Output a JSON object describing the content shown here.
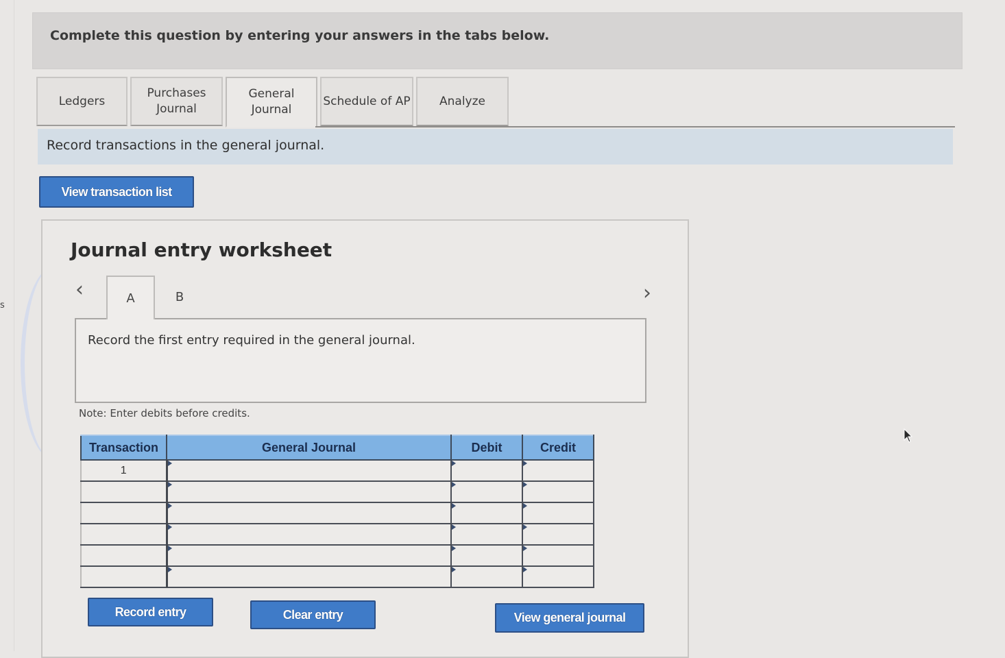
{
  "left_edge": {
    "char": "s"
  },
  "instruction": {
    "text": "Complete this question by entering your answers in the tabs below."
  },
  "tabs": [
    {
      "label_line1": "Ledgers",
      "label_line2": "",
      "active": false
    },
    {
      "label_line1": "Purchases",
      "label_line2": "Journal",
      "active": false
    },
    {
      "label_line1": "General",
      "label_line2": "Journal",
      "active": true
    },
    {
      "label_line1": "Schedule of AP",
      "label_line2": "",
      "active": false
    },
    {
      "label_line1": "Analyze",
      "label_line2": "",
      "active": false
    }
  ],
  "subtitle": {
    "text": "Record transactions in the general journal."
  },
  "buttons": {
    "view_transaction_list": "View transaction list",
    "record_entry": "Record entry",
    "clear_entry": "Clear entry",
    "view_general_journal": "View general journal"
  },
  "worksheet": {
    "title": "Journal entry worksheet",
    "nav_prev_icon": "chevron-left-icon",
    "nav_next_icon": "chevron-right-icon",
    "entry_tabs": [
      {
        "label": "A",
        "active": true
      },
      {
        "label": "B",
        "active": false
      }
    ],
    "entry_instruction": "Record the first entry required in the general journal.",
    "note": "Note: Enter debits before credits."
  },
  "journal_table": {
    "columns": [
      "Transaction",
      "General Journal",
      "Debit",
      "Credit"
    ],
    "rows": [
      {
        "transaction": "1",
        "account": "",
        "debit": "",
        "credit": ""
      },
      {
        "transaction": "",
        "account": "",
        "debit": "",
        "credit": ""
      },
      {
        "transaction": "",
        "account": "",
        "debit": "",
        "credit": ""
      },
      {
        "transaction": "",
        "account": "",
        "debit": "",
        "credit": ""
      },
      {
        "transaction": "",
        "account": "",
        "debit": "",
        "credit": ""
      },
      {
        "transaction": "",
        "account": "",
        "debit": "",
        "credit": ""
      }
    ]
  },
  "colors": {
    "button_blue": "#3f7bc8",
    "table_header_blue": "#7fb2e3",
    "subtitle_bar": "#d3dde6",
    "instruction_bar": "#d6d4d3"
  }
}
